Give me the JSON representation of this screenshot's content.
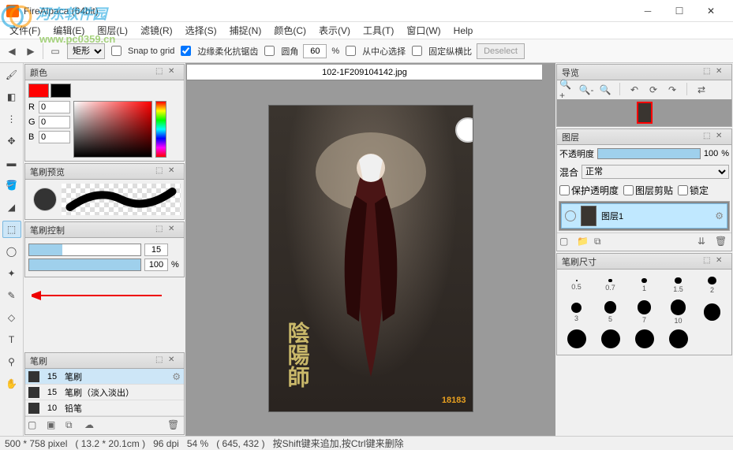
{
  "window": {
    "title": "FireAlpaca (64bit)"
  },
  "watermark": {
    "text": "河东软件园",
    "url": "www.pc0359.cn"
  },
  "menu": {
    "file": "文件(F)",
    "edit": "编辑(E)",
    "layer": "图层(L)",
    "filter": "滤镜(R)",
    "select": "选择(S)",
    "snap": "捕捉(N)",
    "color": "颜色(C)",
    "view": "表示(V)",
    "tools": "工具(T)",
    "window": "窗口(W)",
    "help": "Help"
  },
  "toolbar": {
    "shape": "矩形",
    "snap_label": "Snap to grid",
    "antialias_label": "边缘柔化抗锯齿",
    "round_label": "圆角",
    "round_val": "60",
    "round_unit": "%",
    "center_label": "从中心选择",
    "fixed_label": "固定纵横比",
    "deselect": "Deselect"
  },
  "panels": {
    "color": {
      "title": "颜色",
      "r_label": "R",
      "r_val": "0",
      "g_label": "G",
      "g_val": "0",
      "b_label": "B",
      "b_val": "0"
    },
    "brush_preview": {
      "title": "笔刷预览"
    },
    "brush_control": {
      "title": "笔刷控制",
      "size_val": "15",
      "opacity_val": "100",
      "opacity_unit": "%"
    },
    "brush": {
      "title": "笔刷",
      "items": [
        {
          "size": "15",
          "name": "笔刷"
        },
        {
          "size": "15",
          "name": "笔刷（淡入淡出）"
        },
        {
          "size": "10",
          "name": "铅笔"
        }
      ]
    },
    "nav": {
      "title": "导览"
    },
    "layer": {
      "title": "图层",
      "opacity_label": "不透明度",
      "opacity_val": "100",
      "opacity_unit": "%",
      "blend_label": "混合",
      "blend_val": "正常",
      "protect_label": "保护透明度",
      "clip_label": "图层剪贴",
      "lock_label": "锁定",
      "layer1_name": "图层1"
    },
    "brush_size": {
      "title": "笔刷尺寸",
      "sizes": [
        0.5,
        0.7,
        1,
        1.5,
        2,
        3,
        5,
        7,
        10
      ]
    }
  },
  "canvas": {
    "filename": "102-1F209104142.jpg",
    "artwork_title": "陰陽師",
    "corner_text": "18183"
  },
  "status": {
    "dims": "500 * 758 pixel",
    "cm": "( 13.2 * 20.1cm )",
    "dpi": "96 dpi",
    "zoom": "54 %",
    "coords": "( 645, 432 )",
    "hint": "按Shift键来追加,按Ctrl键来删除"
  }
}
